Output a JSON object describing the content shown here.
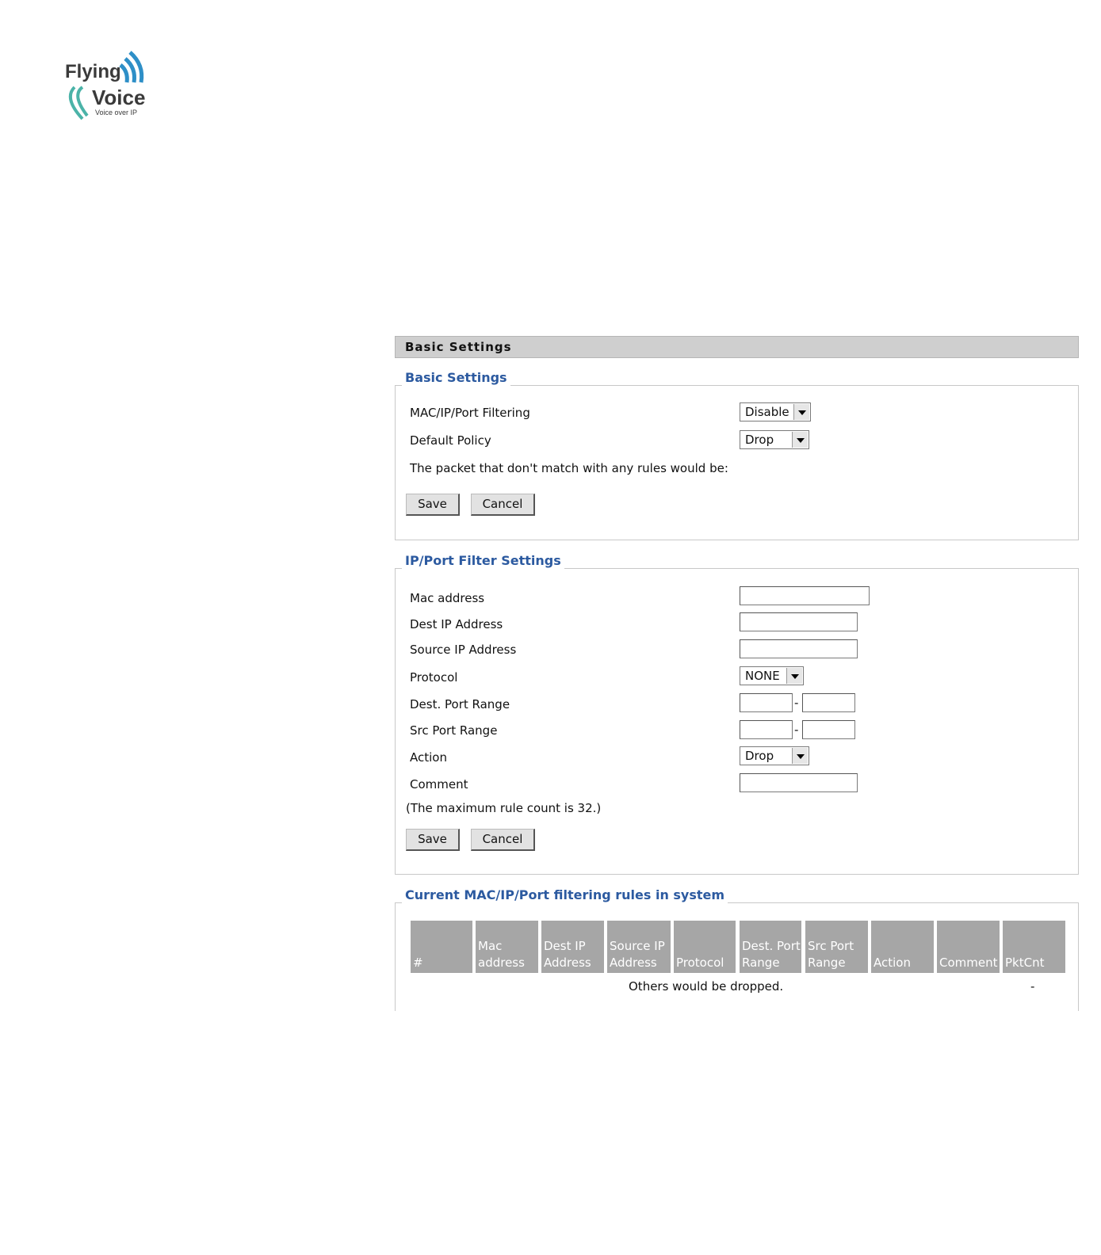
{
  "logo": {
    "line1": "Flying",
    "line2": "Voice",
    "tagline": "Voice over IP"
  },
  "page_header": "Basic Settings",
  "basic_settings": {
    "legend": "Basic Settings",
    "filtering_label": "MAC/IP/Port Filtering",
    "filtering_value": "Disable",
    "policy_label": "Default Policy",
    "policy_value": "Drop",
    "note": "The packet that don't match with any rules would be:",
    "save": "Save",
    "cancel": "Cancel"
  },
  "filter_settings": {
    "legend": "IP/Port Filter Settings",
    "mac_label": "Mac address",
    "dest_ip_label": "Dest IP Address",
    "src_ip_label": "Source IP Address",
    "protocol_label": "Protocol",
    "protocol_value": "NONE",
    "dest_port_label": "Dest. Port Range",
    "src_port_label": "Src Port Range",
    "action_label": "Action",
    "action_value": "Drop",
    "comment_label": "Comment",
    "range_sep": "-",
    "max_note": "(The maximum rule count is 32.)",
    "save": "Save",
    "cancel": "Cancel"
  },
  "rules": {
    "legend": "Current MAC/IP/Port filtering rules in system",
    "columns": [
      "#",
      "Mac address",
      "Dest IP Address",
      "Source IP Address",
      "Protocol",
      "Dest. Port Range",
      "Src Port Range",
      "Action",
      "Comment",
      "PktCnt"
    ],
    "footer_text": "Others would be dropped.",
    "footer_pktcnt": "-"
  }
}
